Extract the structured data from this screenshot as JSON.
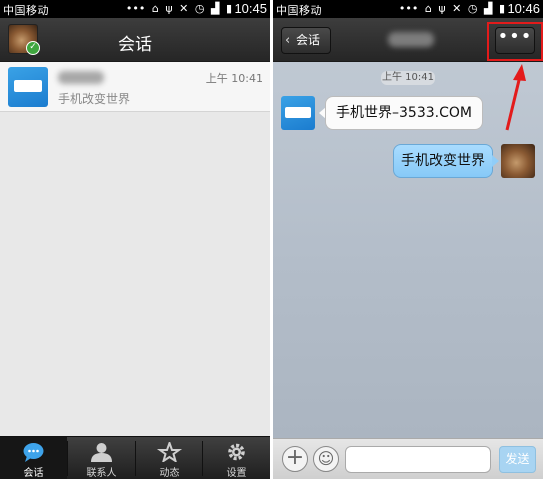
{
  "left": {
    "status": {
      "carrier": "中国移动",
      "time": "10:45"
    },
    "header": {
      "title": "会话"
    },
    "conversation": {
      "time": "上午 10:41",
      "message": "手机改变世界"
    },
    "tabs": [
      {
        "label": "会话",
        "icon": "chat-bubble-icon"
      },
      {
        "label": "联系人",
        "icon": "person-icon"
      },
      {
        "label": "动态",
        "icon": "star-icon"
      },
      {
        "label": "设置",
        "icon": "gear-icon"
      }
    ]
  },
  "right": {
    "status": {
      "carrier": "中国移动",
      "time": "10:46"
    },
    "header": {
      "back_label": "会话",
      "more_label": "•••"
    },
    "chat": {
      "timestamp": "上午 10:41",
      "incoming": "手机世界–3533.COM",
      "outgoing": "手机改变世界"
    },
    "input": {
      "send_label": "发送",
      "placeholder": ""
    }
  },
  "colors": {
    "highlight": "#e31b1b",
    "accent": "#86c9f7",
    "brand": "#1b7ccf"
  }
}
